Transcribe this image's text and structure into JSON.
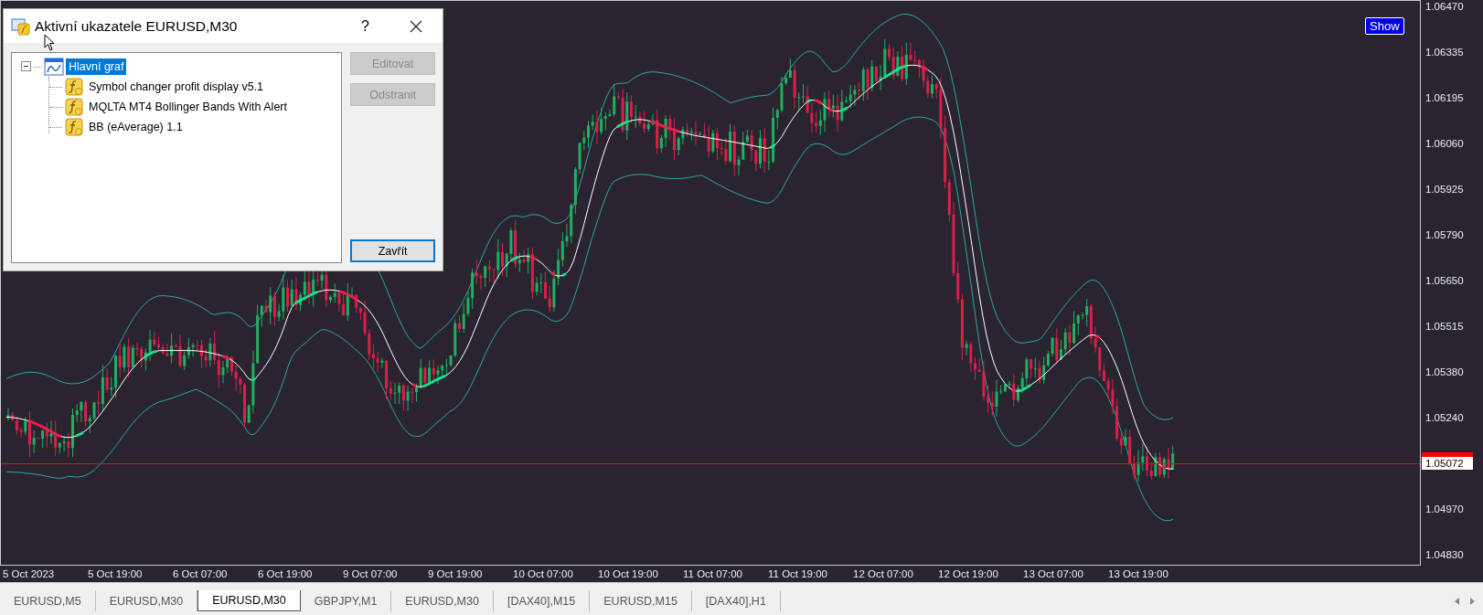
{
  "dialog": {
    "title": "Aktivní ukazatele EURUSD,M30",
    "help": "?",
    "tree": [
      {
        "label": "Hlavní graf",
        "selected": true,
        "expanded": true,
        "children": [
          {
            "label": "Symbol changer profit display v5.1",
            "selected": false
          },
          {
            "label": "MQLTA MT4 Bollinger Bands With Alert",
            "selected": false
          },
          {
            "label": "BB (eAverage) 1.1",
            "selected": false
          }
        ]
      }
    ],
    "buttons": [
      {
        "label": "Editovat",
        "disabled": true,
        "focused": false,
        "kind": "top"
      },
      {
        "label": "Odstranit",
        "disabled": true,
        "focused": false,
        "kind": "top"
      },
      {
        "label": "Zavřít",
        "disabled": false,
        "focused": true,
        "kind": "bottom"
      }
    ]
  },
  "chart": {
    "show_button": "Show",
    "price_labels": [
      {
        "text": "1.06470",
        "kind": "tick"
      },
      {
        "text": "1.06335",
        "kind": "tick"
      },
      {
        "text": "1.06195",
        "kind": "tick"
      },
      {
        "text": "1.06060",
        "kind": "tick"
      },
      {
        "text": "1.05925",
        "kind": "tick"
      },
      {
        "text": "1.05790",
        "kind": "tick"
      },
      {
        "text": "1.05650",
        "kind": "tick"
      },
      {
        "text": "1.05515",
        "kind": "tick"
      },
      {
        "text": "1.05380",
        "kind": "tick"
      },
      {
        "text": "1.05240",
        "kind": "tick"
      },
      {
        "text": "1.05072",
        "kind": "current"
      },
      {
        "text": "1.04970",
        "kind": "tick"
      },
      {
        "text": "1.04830",
        "kind": "tick"
      }
    ],
    "time_labels": [
      "5 Oct 2023",
      "5 Oct 19:00",
      "6 Oct 07:00",
      "6 Oct 19:00",
      "9 Oct 07:00",
      "9 Oct 19:00",
      "10 Oct 07:00",
      "10 Oct 19:00",
      "11 Oct 07:00",
      "11 Oct 19:00",
      "12 Oct 07:00",
      "12 Oct 19:00",
      "13 Oct 07:00",
      "13 Oct 19:00"
    ]
  },
  "tabs": [
    {
      "label": "EURUSD,M5",
      "selected": false
    },
    {
      "label": "EURUSD,M30",
      "selected": false
    },
    {
      "label": "EURUSD,M30",
      "selected": true
    },
    {
      "label": "GBPJPY,M1",
      "selected": false
    },
    {
      "label": "EURUSD,M30",
      "selected": false
    },
    {
      "label": "[DAX40],M15",
      "selected": false
    },
    {
      "label": "EURUSD,M15",
      "selected": false
    },
    {
      "label": "[DAX40],H1",
      "selected": false
    }
  ]
}
